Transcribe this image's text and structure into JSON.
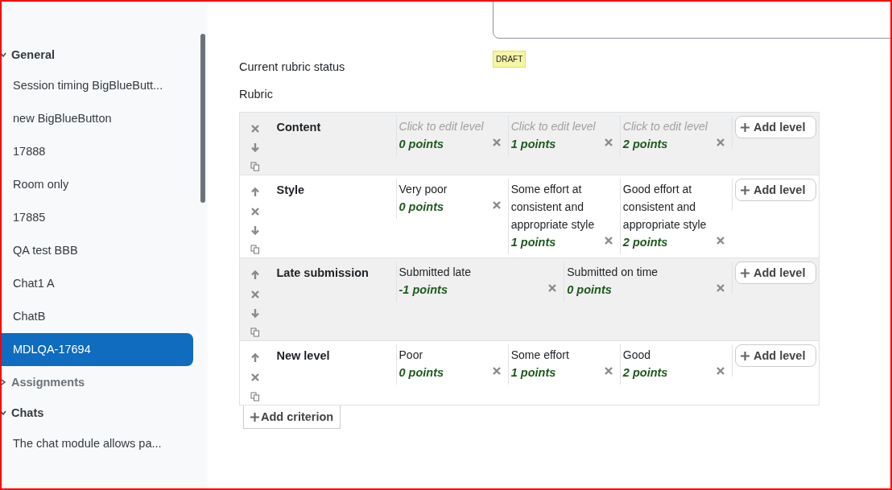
{
  "sidebar": {
    "sections": [
      {
        "title": "General",
        "expanded": true,
        "items": [
          {
            "label": "Session timing BigBlueButt...",
            "selected": false
          },
          {
            "label": "new BigBlueButton",
            "selected": false
          },
          {
            "label": "17888",
            "selected": false
          },
          {
            "label": "Room only",
            "selected": false
          },
          {
            "label": "17885",
            "selected": false
          },
          {
            "label": "QA test BBB",
            "selected": false
          },
          {
            "label": "Chat1 A",
            "selected": false
          },
          {
            "label": "ChatB",
            "selected": false
          },
          {
            "label": "MDLQA-17694",
            "selected": true
          }
        ]
      },
      {
        "title": "Assignments",
        "expanded": false
      },
      {
        "title": "Chats",
        "expanded": true,
        "items": [
          {
            "label": "The chat module allows pa...",
            "selected": false
          }
        ]
      }
    ]
  },
  "status": {
    "label": "Current rubric status",
    "badge": "DRAFT"
  },
  "rubric": {
    "label": "Rubric",
    "add_criterion_label": "Add criterion",
    "criteria": [
      {
        "description": "Content",
        "add_level_label": "Add level",
        "actions": [
          {
            "kind": "delete"
          },
          {
            "kind": "down"
          },
          {
            "kind": "duplicate"
          }
        ],
        "levels": [
          {
            "definition": "Click to edit level",
            "placeholder": true,
            "points": "0 points"
          },
          {
            "definition": "Click to edit level",
            "placeholder": true,
            "points": "1 points"
          },
          {
            "definition": "Click to edit level",
            "placeholder": true,
            "points": "2 points"
          }
        ]
      },
      {
        "description": "Style",
        "add_level_label": "Add level",
        "actions": [
          {
            "kind": "up"
          },
          {
            "kind": "delete"
          },
          {
            "kind": "down"
          },
          {
            "kind": "duplicate"
          }
        ],
        "levels": [
          {
            "definition": "Very poor",
            "placeholder": false,
            "points": "0 points"
          },
          {
            "definition": "Some effort at consistent and appropriate style",
            "placeholder": false,
            "points": "1 points"
          },
          {
            "definition": "Good effort at consistent and appropriate style",
            "placeholder": false,
            "points": "2 points"
          }
        ]
      },
      {
        "description": "Late submission",
        "add_level_label": "Add level",
        "actions": [
          {
            "kind": "up"
          },
          {
            "kind": "delete"
          },
          {
            "kind": "down"
          },
          {
            "kind": "duplicate"
          }
        ],
        "levels": [
          {
            "definition": "Submitted late",
            "placeholder": false,
            "points": "-1 points"
          },
          {
            "definition": "Submitted on time",
            "placeholder": false,
            "points": "0 points"
          }
        ]
      },
      {
        "description": "New level",
        "add_level_label": "Add level",
        "actions": [
          {
            "kind": "up"
          },
          {
            "kind": "delete"
          },
          {
            "kind": "duplicate"
          }
        ],
        "levels": [
          {
            "definition": "Poor",
            "placeholder": false,
            "points": "0 points"
          },
          {
            "definition": "Some effort",
            "placeholder": false,
            "points": "1 points"
          },
          {
            "definition": "Good",
            "placeholder": false,
            "points": "2 points"
          }
        ]
      }
    ]
  }
}
